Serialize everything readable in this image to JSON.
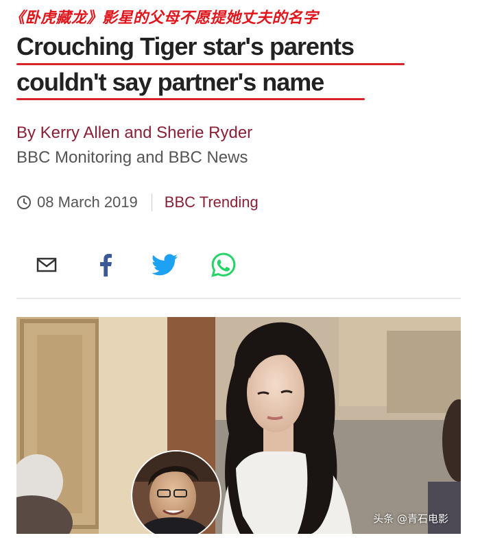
{
  "annotation": {
    "chinese_title": "《卧虎藏龙》影星的父母不愿提她丈夫的名字"
  },
  "article": {
    "headline_line1": "Crouching Tiger star's parents",
    "headline_line2": "couldn't say partner's name",
    "byline": "By Kerry Allen and Sherie Ryder",
    "source": "BBC Monitoring and BBC News",
    "date": "08 March 2019",
    "category": "BBC Trending"
  },
  "share": {
    "icons": [
      "email-icon",
      "facebook-icon",
      "twitter-icon",
      "whatsapp-icon"
    ]
  },
  "image": {
    "watermark": "头条 @青石电影"
  },
  "colors": {
    "annotation_red": "#e0151b",
    "underline_red": "#d8232a",
    "byline_maroon": "#8a1f35",
    "twitter_blue": "#1da1f2",
    "whatsapp_green": "#25d366"
  }
}
